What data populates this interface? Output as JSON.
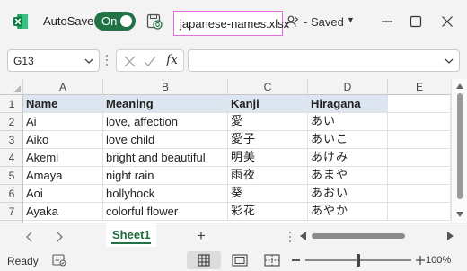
{
  "titlebar": {
    "autosave_label": "AutoSave",
    "autosave_state": "On",
    "filename": "japanese-names.xlsx",
    "status": "- Saved",
    "accent_color": "#217346",
    "highlight_color": "#e36be0"
  },
  "formula_bar": {
    "name_box": "G13",
    "fx_label": "fx",
    "formula": ""
  },
  "grid": {
    "columns": [
      "A",
      "B",
      "C",
      "D",
      "E"
    ],
    "row_numbers": [
      "1",
      "2",
      "3",
      "4",
      "5",
      "6",
      "7"
    ],
    "header_fill": "#dde5f0",
    "rows": [
      [
        "Name",
        "Meaning",
        "Kanji",
        "Hiragana",
        ""
      ],
      [
        "Ai",
        "love, affection",
        "愛",
        "あい",
        ""
      ],
      [
        "Aiko",
        "love child",
        "愛子",
        "あいこ",
        ""
      ],
      [
        "Akemi",
        "bright and beautiful",
        "明美",
        "あけみ",
        ""
      ],
      [
        "Amaya",
        "night rain",
        "雨夜",
        "あまや",
        ""
      ],
      [
        "Aoi",
        "hollyhock",
        "葵",
        "あおい",
        ""
      ],
      [
        "Ayaka",
        "colorful flower",
        "彩花",
        "あやか",
        ""
      ]
    ]
  },
  "sheets": {
    "active": "Sheet1",
    "add_label": "+"
  },
  "statusbar": {
    "ready": "Ready",
    "zoom": "100%",
    "zoom_level_percent": 100
  }
}
